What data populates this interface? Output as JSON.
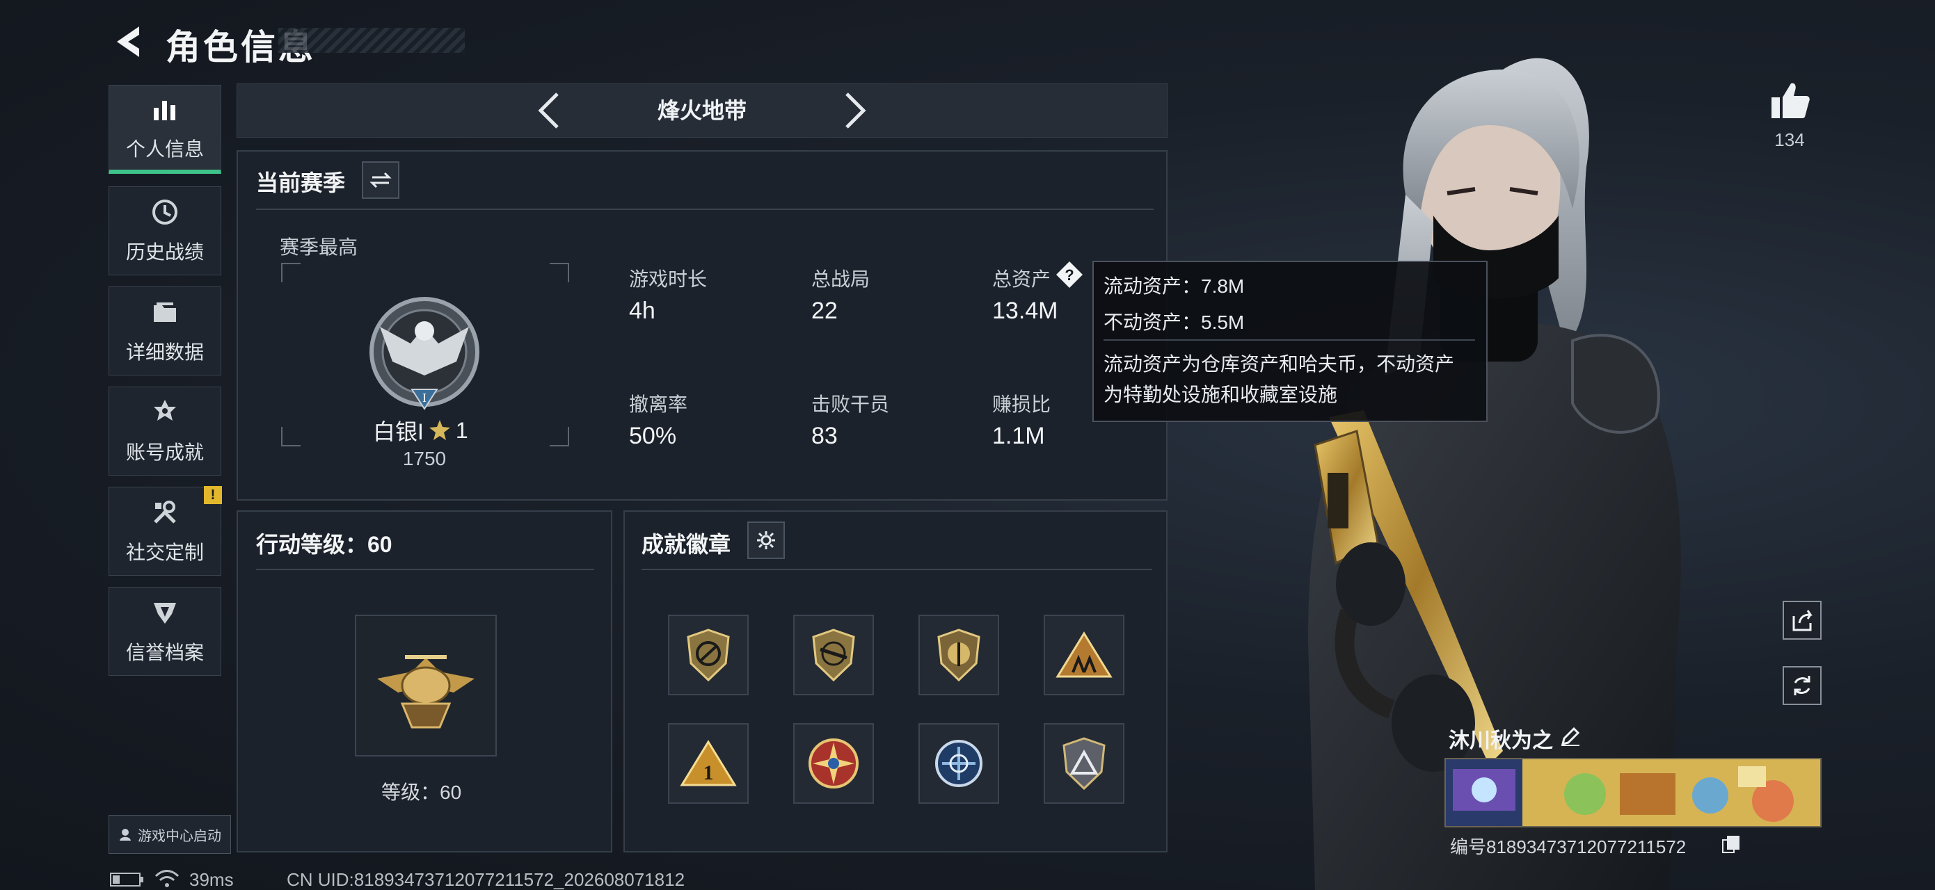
{
  "header": {
    "title": "角色信息"
  },
  "sidebar": {
    "items": [
      {
        "label": "个人信息",
        "icon": "bar-chart-icon",
        "active": true
      },
      {
        "label": "历史战绩",
        "icon": "history-clock-icon",
        "active": false
      },
      {
        "label": "详细数据",
        "icon": "folder-icon",
        "active": false
      },
      {
        "label": "账号成就",
        "icon": "medal-icon",
        "active": false
      },
      {
        "label": "社交定制",
        "icon": "tools-icon",
        "active": false,
        "badge": "!"
      },
      {
        "label": "信誉档案",
        "icon": "reputation-icon",
        "active": false
      }
    ],
    "game_center_label": "游戏中心启动"
  },
  "map_selector": {
    "name": "烽火地带"
  },
  "season": {
    "title": "当前赛季",
    "best_label": "赛季最高",
    "rank_name": "白银I",
    "rank_stars": "1",
    "rank_score": "1750",
    "rank_emblem_numeral": "I",
    "stats": [
      {
        "label": "游戏时长",
        "value": "4h"
      },
      {
        "label": "总战局",
        "value": "22"
      },
      {
        "label": "总资产",
        "value": "13.4M"
      },
      {
        "label": "撤离率",
        "value": "50%"
      },
      {
        "label": "击败干员",
        "value": "83"
      },
      {
        "label": "赚损比",
        "value": "1.1M"
      }
    ]
  },
  "tooltip": {
    "liquid": "流动资产：7.8M",
    "fixed": "不动资产：5.5M",
    "desc_line1": "流动资产为仓库资产和哈夫币，不动资产",
    "desc_line2": "为特勤处设施和收藏室设施"
  },
  "action_level": {
    "title": "行动等级：60",
    "level_label": "等级：60"
  },
  "badges": {
    "title": "成就徽章",
    "items": [
      "badge-1",
      "badge-2",
      "badge-3",
      "badge-4",
      "badge-5",
      "badge-6",
      "badge-7",
      "badge-8"
    ]
  },
  "profile": {
    "likes": "134",
    "player_name": "沐川秋为之",
    "player_id": "编号818934737120772115​72"
  },
  "status_bar": {
    "ping": "39ms",
    "uid": "CN UID:818934737120772115​72_202608071812"
  },
  "colors": {
    "accent": "#3ec48a",
    "warning": "#e2b72b",
    "gold": "#c9a24a"
  }
}
